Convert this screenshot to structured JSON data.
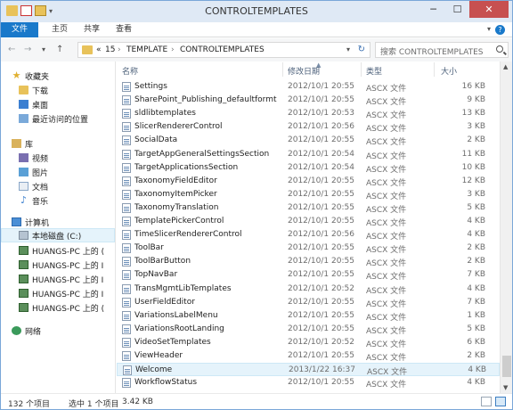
{
  "window": {
    "title": "CONTROLTEMPLATES",
    "minimize": "─",
    "maximize": "☐",
    "close": "✕"
  },
  "ribbon": {
    "tabs": [
      "文件",
      "主页",
      "共享",
      "查看"
    ],
    "help": "?"
  },
  "nav": {
    "back": "←",
    "forward": "→",
    "recent": "▾",
    "up": "↑"
  },
  "address": {
    "prefix": "«",
    "crumbs": [
      "15",
      "TEMPLATE",
      "CONTROLTEMPLATES"
    ],
    "separator": "›",
    "dropdown": "▾",
    "refresh": "↻"
  },
  "search": {
    "placeholder": "搜索 CONTROLTEMPLATES"
  },
  "navpane": {
    "favorites": {
      "label": "收藏夹",
      "items": [
        "下载",
        "桌面",
        "最近访问的位置"
      ]
    },
    "libraries": {
      "label": "库",
      "items": [
        "视频",
        "图片",
        "文档",
        "音乐"
      ]
    },
    "computer": {
      "label": "计算机",
      "items": [
        "本地磁盘 (C:)",
        "HUANGS-PC 上的 (",
        "HUANGS-PC 上的 I",
        "HUANGS-PC 上的 I",
        "HUANGS-PC 上的 I",
        "HUANGS-PC 上的 ("
      ]
    },
    "network": {
      "label": "网络"
    }
  },
  "columns": {
    "name": "名称",
    "date": "修改日期",
    "type": "类型",
    "size": "大小",
    "sort_arrow": "▲"
  },
  "files": [
    {
      "name": "Settings",
      "date": "2012/10/1 20:55",
      "type": "ASCX 文件",
      "size": "16 KB"
    },
    {
      "name": "SharePoint_Publishing_defaultformte...",
      "date": "2012/10/1 20:55",
      "type": "ASCX 文件",
      "size": "9 KB"
    },
    {
      "name": "sldlibtemplates",
      "date": "2012/10/1 20:53",
      "type": "ASCX 文件",
      "size": "13 KB"
    },
    {
      "name": "SlicerRendererControl",
      "date": "2012/10/1 20:56",
      "type": "ASCX 文件",
      "size": "3 KB"
    },
    {
      "name": "SocialData",
      "date": "2012/10/1 20:55",
      "type": "ASCX 文件",
      "size": "2 KB"
    },
    {
      "name": "TargetAppGeneralSettingsSection",
      "date": "2012/10/1 20:54",
      "type": "ASCX 文件",
      "size": "11 KB"
    },
    {
      "name": "TargetApplicationsSection",
      "date": "2012/10/1 20:54",
      "type": "ASCX 文件",
      "size": "10 KB"
    },
    {
      "name": "TaxonomyFieldEditor",
      "date": "2012/10/1 20:55",
      "type": "ASCX 文件",
      "size": "12 KB"
    },
    {
      "name": "TaxonomyItemPicker",
      "date": "2012/10/1 20:55",
      "type": "ASCX 文件",
      "size": "3 KB"
    },
    {
      "name": "TaxonomyTranslation",
      "date": "2012/10/1 20:55",
      "type": "ASCX 文件",
      "size": "5 KB"
    },
    {
      "name": "TemplatePickerControl",
      "date": "2012/10/1 20:55",
      "type": "ASCX 文件",
      "size": "4 KB"
    },
    {
      "name": "TimeSlicerRendererControl",
      "date": "2012/10/1 20:56",
      "type": "ASCX 文件",
      "size": "4 KB"
    },
    {
      "name": "ToolBar",
      "date": "2012/10/1 20:55",
      "type": "ASCX 文件",
      "size": "2 KB"
    },
    {
      "name": "ToolBarButton",
      "date": "2012/10/1 20:55",
      "type": "ASCX 文件",
      "size": "2 KB"
    },
    {
      "name": "TopNavBar",
      "date": "2012/10/1 20:55",
      "type": "ASCX 文件",
      "size": "7 KB"
    },
    {
      "name": "TransMgmtLibTemplates",
      "date": "2012/10/1 20:52",
      "type": "ASCX 文件",
      "size": "4 KB"
    },
    {
      "name": "UserFieldEditor",
      "date": "2012/10/1 20:55",
      "type": "ASCX 文件",
      "size": "7 KB"
    },
    {
      "name": "VariationsLabelMenu",
      "date": "2012/10/1 20:55",
      "type": "ASCX 文件",
      "size": "1 KB"
    },
    {
      "name": "VariationsRootLanding",
      "date": "2012/10/1 20:55",
      "type": "ASCX 文件",
      "size": "5 KB"
    },
    {
      "name": "VideoSetTemplates",
      "date": "2012/10/1 20:52",
      "type": "ASCX 文件",
      "size": "6 KB"
    },
    {
      "name": "ViewHeader",
      "date": "2012/10/1 20:55",
      "type": "ASCX 文件",
      "size": "2 KB"
    },
    {
      "name": "Welcome",
      "date": "2013/1/22 16:37",
      "type": "ASCX 文件",
      "size": "4 KB",
      "selected": true
    },
    {
      "name": "WorkflowStatus",
      "date": "2012/10/1 20:55",
      "type": "ASCX 文件",
      "size": "4 KB"
    }
  ],
  "status": {
    "count": "132 个项目",
    "selection": "选中 1 个项目",
    "size": "3.42 KB"
  }
}
